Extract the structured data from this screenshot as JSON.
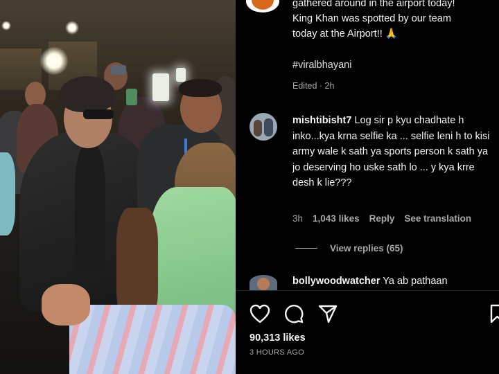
{
  "post": {
    "caption_lines": [
      "gathered around in the airport today!",
      "King Khan was spotted by our team",
      "today at the Airport!! 🙏"
    ],
    "hashtag": "#viralbhayani",
    "edited": "Edited · 2h"
  },
  "comments": [
    {
      "username": "mishtibisht7",
      "text": "Log sir p kyu chadhate h inko...kya krna selfie ka ... selfie leni h to kisi army wale k sath ya sports person k sath ya jo deserving ho uske sath lo ... y kya krre desh k lie???",
      "time": "3h",
      "likes": "1,043 likes",
      "reply": "Reply",
      "translate": "See translation",
      "view_replies": "View replies (65)"
    },
    {
      "username": "bollywoodwatcher",
      "text": "Ya ab pathaan"
    }
  ],
  "actions": {
    "like_icon": "heart-icon",
    "comment_icon": "comment-icon",
    "share_icon": "share-icon",
    "save_icon": "bookmark-icon"
  },
  "stats": {
    "likes": "90,313 likes",
    "posted": "3 HOURS AGO"
  }
}
